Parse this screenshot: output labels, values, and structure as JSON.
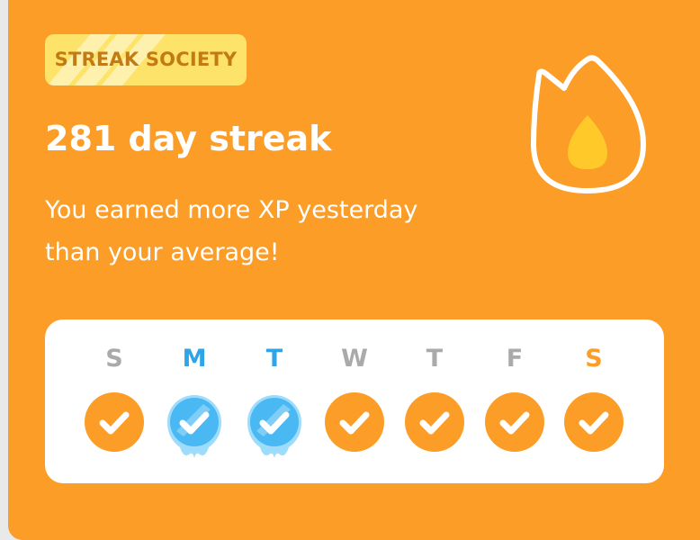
{
  "badge": {
    "label": "STREAK SOCIETY"
  },
  "streak": {
    "title": "281 day streak",
    "message_line1": "You earned more XP yesterday",
    "message_line2": "than your average!"
  },
  "colors": {
    "card_bg": "#fb9d27",
    "badge_bg": "#fde36a",
    "badge_text": "#c27a15",
    "check_orange": "#fb9d27",
    "freeze_blue": "#49b8f3",
    "inactive_letter": "#aaaaaa",
    "active_letter_blue": "#2fa4e7",
    "today_letter": "#fb9d27"
  },
  "week": {
    "days": [
      {
        "letter": "S",
        "status": "completed"
      },
      {
        "letter": "M",
        "status": "freeze"
      },
      {
        "letter": "T",
        "status": "freeze"
      },
      {
        "letter": "W",
        "status": "completed"
      },
      {
        "letter": "T",
        "status": "completed"
      },
      {
        "letter": "F",
        "status": "completed"
      },
      {
        "letter": "S",
        "status": "completed"
      }
    ]
  }
}
